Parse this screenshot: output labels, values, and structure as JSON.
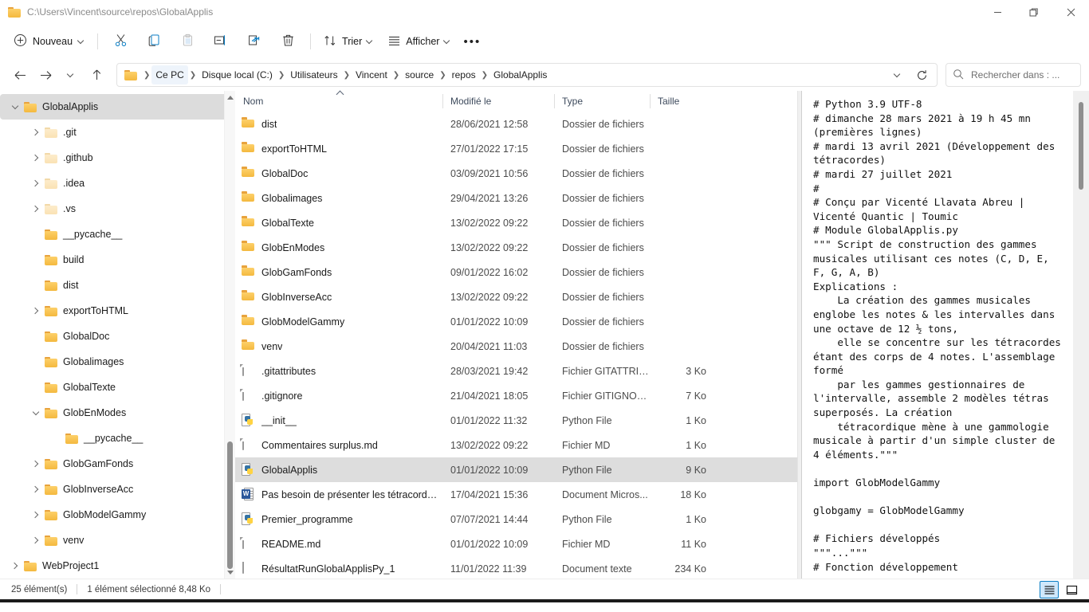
{
  "window": {
    "title": "C:\\Users\\Vincent\\source\\repos\\GlobalApplis",
    "minimize_label": "Réduire",
    "maximize_label": "Agrandir",
    "close_label": "Fermer"
  },
  "toolbar": {
    "new_label": "Nouveau",
    "cut_label": "Couper",
    "copy_label": "Copier",
    "paste_label": "Coller",
    "rename_label": "Renommer",
    "share_label": "Partager",
    "delete_label": "Supprimer",
    "sort_label": "Trier",
    "view_label": "Afficher",
    "more_label": "Voir plus"
  },
  "address": {
    "back_label": "Précédent",
    "forward_label": "Suivant",
    "recent_label": "Emplacements récents",
    "up_label": "Monter d'un niveau",
    "refresh_label": "Actualiser",
    "breadcrumbs": [
      "Ce PC",
      "Disque local (C:)",
      "Utilisateurs",
      "Vincent",
      "source",
      "repos",
      "GlobalApplis"
    ],
    "active_crumb_index": 0
  },
  "search": {
    "placeholder": "Rechercher dans : ..."
  },
  "nav_tree": [
    {
      "label": "GlobalApplis",
      "indent": 1,
      "twisty": "open",
      "selected": true,
      "pale": false
    },
    {
      "label": ".git",
      "indent": 2,
      "twisty": "closed",
      "selected": false,
      "pale": true
    },
    {
      "label": ".github",
      "indent": 2,
      "twisty": "closed",
      "selected": false,
      "pale": true
    },
    {
      "label": ".idea",
      "indent": 2,
      "twisty": "closed",
      "selected": false,
      "pale": true
    },
    {
      "label": ".vs",
      "indent": 2,
      "twisty": "closed",
      "selected": false,
      "pale": true
    },
    {
      "label": "__pycache__",
      "indent": 2,
      "twisty": "none",
      "selected": false,
      "pale": false
    },
    {
      "label": "build",
      "indent": 2,
      "twisty": "none",
      "selected": false,
      "pale": false
    },
    {
      "label": "dist",
      "indent": 2,
      "twisty": "none",
      "selected": false,
      "pale": false
    },
    {
      "label": "exportToHTML",
      "indent": 2,
      "twisty": "closed",
      "selected": false,
      "pale": false
    },
    {
      "label": "GlobalDoc",
      "indent": 2,
      "twisty": "none",
      "selected": false,
      "pale": false
    },
    {
      "label": "Globalimages",
      "indent": 2,
      "twisty": "none",
      "selected": false,
      "pale": false
    },
    {
      "label": "GlobalTexte",
      "indent": 2,
      "twisty": "none",
      "selected": false,
      "pale": false
    },
    {
      "label": "GlobEnModes",
      "indent": 2,
      "twisty": "open",
      "selected": false,
      "pale": false
    },
    {
      "label": "__pycache__",
      "indent": 3,
      "twisty": "none",
      "selected": false,
      "pale": false
    },
    {
      "label": "GlobGamFonds",
      "indent": 2,
      "twisty": "closed",
      "selected": false,
      "pale": false
    },
    {
      "label": "GlobInverseAcc",
      "indent": 2,
      "twisty": "closed",
      "selected": false,
      "pale": false
    },
    {
      "label": "GlobModelGammy",
      "indent": 2,
      "twisty": "closed",
      "selected": false,
      "pale": false
    },
    {
      "label": "venv",
      "indent": 2,
      "twisty": "closed",
      "selected": false,
      "pale": false
    },
    {
      "label": "WebProject1",
      "indent": 1,
      "twisty": "closed",
      "selected": false,
      "pale": false
    }
  ],
  "file_list": {
    "columns": [
      "Nom",
      "Modifié le",
      "Type",
      "Taille"
    ],
    "sort_column": "Nom",
    "sort_direction": "ascending",
    "rows": [
      {
        "name": "dist",
        "modified": "28/06/2021 12:58",
        "type": "Dossier de fichiers",
        "size": "",
        "icon": "folder",
        "selected": false
      },
      {
        "name": "exportToHTML",
        "modified": "27/01/2022 17:15",
        "type": "Dossier de fichiers",
        "size": "",
        "icon": "folder",
        "selected": false
      },
      {
        "name": "GlobalDoc",
        "modified": "03/09/2021 10:56",
        "type": "Dossier de fichiers",
        "size": "",
        "icon": "folder",
        "selected": false
      },
      {
        "name": "Globalimages",
        "modified": "29/04/2021 13:26",
        "type": "Dossier de fichiers",
        "size": "",
        "icon": "folder",
        "selected": false
      },
      {
        "name": "GlobalTexte",
        "modified": "13/02/2022 09:22",
        "type": "Dossier de fichiers",
        "size": "",
        "icon": "folder",
        "selected": false
      },
      {
        "name": "GlobEnModes",
        "modified": "13/02/2022 09:22",
        "type": "Dossier de fichiers",
        "size": "",
        "icon": "folder",
        "selected": false
      },
      {
        "name": "GlobGamFonds",
        "modified": "09/01/2022 16:02",
        "type": "Dossier de fichiers",
        "size": "",
        "icon": "folder",
        "selected": false
      },
      {
        "name": "GlobInverseAcc",
        "modified": "13/02/2022 09:22",
        "type": "Dossier de fichiers",
        "size": "",
        "icon": "folder",
        "selected": false
      },
      {
        "name": "GlobModelGammy",
        "modified": "01/01/2022 10:09",
        "type": "Dossier de fichiers",
        "size": "",
        "icon": "folder",
        "selected": false
      },
      {
        "name": "venv",
        "modified": "20/04/2021 11:03",
        "type": "Dossier de fichiers",
        "size": "",
        "icon": "folder",
        "selected": false
      },
      {
        "name": ".gitattributes",
        "modified": "28/03/2021 19:42",
        "type": "Fichier GITATTRIB...",
        "size": "3 Ko",
        "icon": "document",
        "selected": false
      },
      {
        "name": ".gitignore",
        "modified": "21/04/2021 18:05",
        "type": "Fichier GITIGNORE",
        "size": "7 Ko",
        "icon": "document",
        "selected": false
      },
      {
        "name": "__init__",
        "modified": "01/01/2022 11:32",
        "type": "Python File",
        "size": "1 Ko",
        "icon": "python",
        "selected": false
      },
      {
        "name": "Commentaires surplus.md",
        "modified": "13/02/2022 09:22",
        "type": "Fichier MD",
        "size": "1 Ko",
        "icon": "document",
        "selected": false
      },
      {
        "name": "GlobalApplis",
        "modified": "01/01/2022 10:09",
        "type": "Python File",
        "size": "9 Ko",
        "icon": "python",
        "selected": true
      },
      {
        "name": "Pas besoin de présenter les tétracordes d...",
        "modified": "17/04/2021 15:36",
        "type": "Document Micros...",
        "size": "18 Ko",
        "icon": "word",
        "selected": false
      },
      {
        "name": "Premier_programme",
        "modified": "07/07/2021 14:44",
        "type": "Python File",
        "size": "1 Ko",
        "icon": "python",
        "selected": false
      },
      {
        "name": "README.md",
        "modified": "01/01/2022 10:09",
        "type": "Fichier MD",
        "size": "11 Ko",
        "icon": "document",
        "selected": false
      },
      {
        "name": "RésultatRunGlobalApplisPy_1",
        "modified": "11/01/2022 11:39",
        "type": "Document texte",
        "size": "234 Ko",
        "icon": "text",
        "selected": false
      }
    ]
  },
  "preview": {
    "content": "# Python 3.9 UTF-8\n# dimanche 28 mars 2021 à 19 h 45 mn (premières lignes)\n# mardi 13 avril 2021 (Développement des tétracordes)\n# mardi 27 juillet 2021\n#\n# Conçu par Vicenté Llavata Abreu | Vicenté Quantic | Toumic\n# Module GlobalApplis.py\n\"\"\" Script de construction des gammes musicales utilisant ces notes (C, D, E, F, G, A, B)\nExplications :\n    La création des gammes musicales englobe les notes & les intervalles dans une octave de 12 ½ tons,\n    elle se concentre sur les tétracordes étant des corps de 4 notes. L'assemblage formé\n    par les gammes gestionnaires de l'intervalle, assemble 2 modèles tétras superposés. La création\n    tétracordique mène à une gammologie musicale à partir d'un simple cluster de 4 éléments.\"\"\"\n\nimport GlobModelGammy\n\nglobgamy = GlobModelGammy\n\n# Fichiers développés\n\"\"\"...\"\"\"\n# Fonction développement"
  },
  "statusbar": {
    "item_count": "25 élément(s)",
    "selection": "1 élément sélectionné  8,48 Ko",
    "details_view_label": "Détails",
    "tiles_view_label": "Volet de détails"
  },
  "colors": {
    "accent": "#0b7ec4",
    "folder": "#f4b93f",
    "selection": "#dddddd",
    "python_blue": "#3573a5",
    "python_yellow": "#ffd343",
    "word_blue": "#2b579a"
  }
}
